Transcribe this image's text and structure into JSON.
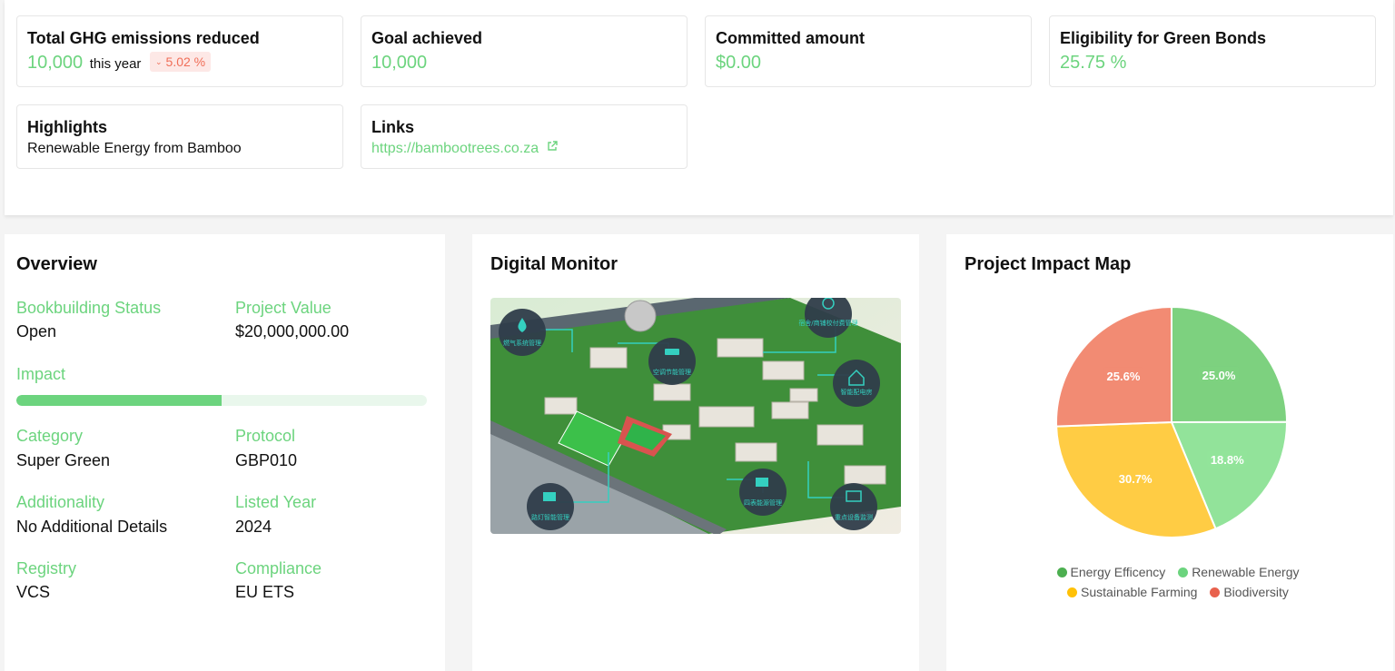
{
  "cards": {
    "ghg": {
      "title": "Total GHG emissions reduced",
      "value": "10,000",
      "suffix": "this year",
      "delta": "5.02 %"
    },
    "goal": {
      "title": "Goal achieved",
      "value": "10,000"
    },
    "committed": {
      "title": "Committed amount",
      "value": "$0.00"
    },
    "eligibility": {
      "title": "Eligibility for Green Bonds",
      "value": "25.75 %"
    },
    "highlights": {
      "title": "Highlights",
      "text": "Renewable Energy from Bamboo"
    },
    "links": {
      "title": "Links",
      "url": "https://bambootrees.co.za"
    }
  },
  "overview": {
    "title": "Overview",
    "bookbuilding_label": "Bookbuilding Status",
    "bookbuilding_value": "Open",
    "project_value_label": "Project Value",
    "project_value": "$20,000,000.00",
    "impact_label": "Impact",
    "impact_progress": 0.5,
    "category_label": "Category",
    "category_value": "Super Green",
    "protocol_label": "Protocol",
    "protocol_value": "GBP010",
    "additionality_label": "Additionality",
    "additionality_value": "No Additional Details",
    "listed_year_label": "Listed Year",
    "listed_year_value": "2024",
    "registry_label": "Registry",
    "registry_value": "VCS",
    "compliance_label": "Compliance",
    "compliance_value": "EU ETS"
  },
  "monitor": {
    "title": "Digital Monitor",
    "nodes": [
      "燃气系统管理",
      "空调节能管理",
      "宿舍/商铺校付费管理",
      "智能配电房",
      "路灯智能管理",
      "四表能源管理",
      "重点设备监测"
    ]
  },
  "impact_map": {
    "title": "Project Impact Map",
    "colors": {
      "energy": "#7dd17f",
      "renewable": "#92e39a",
      "farming": "#ffcc44",
      "biodiversity": "#f28b73"
    }
  },
  "chart_data": {
    "type": "pie",
    "title": "Project Impact Map",
    "series": [
      {
        "name": "Energy Efficency",
        "value": 25.0,
        "label": "25.0%",
        "color": "#7dd17f",
        "legend_color": "#4caf50"
      },
      {
        "name": "Renewable Energy",
        "value": 18.8,
        "label": "18.8%",
        "color": "#92e39a",
        "legend_color": "#6cd47e"
      },
      {
        "name": "Sustainable Farming",
        "value": 30.7,
        "label": "30.7%",
        "color": "#ffcc44",
        "legend_color": "#ffc107"
      },
      {
        "name": "Biodiversity",
        "value": 25.6,
        "label": "25.6%",
        "color": "#f28b73",
        "legend_color": "#e8614d"
      }
    ],
    "legend": "bottom"
  }
}
